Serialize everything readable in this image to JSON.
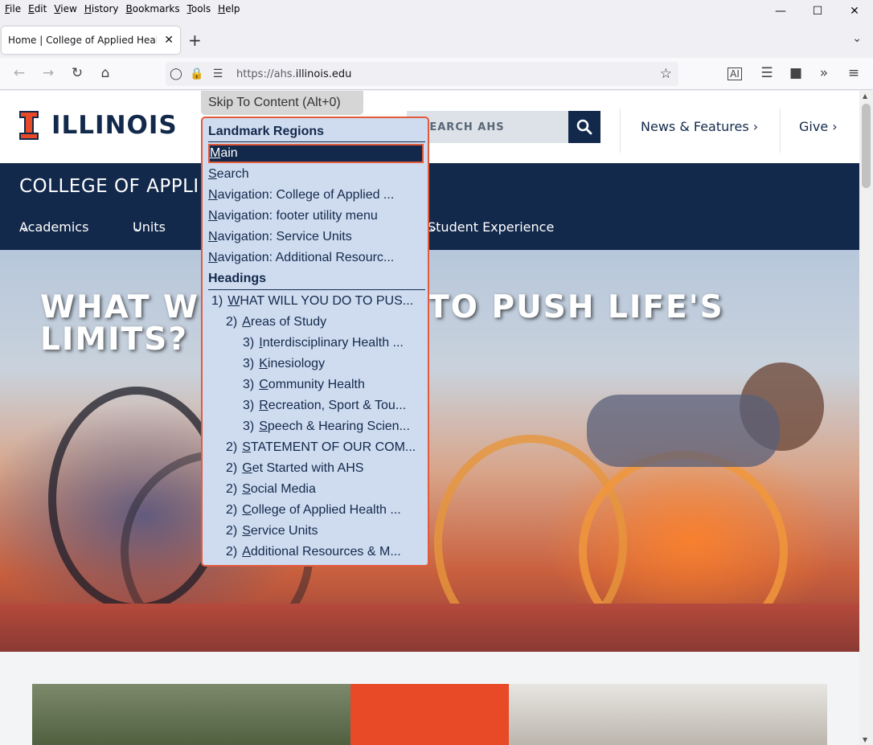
{
  "menubar": [
    "File",
    "Edit",
    "View",
    "History",
    "Bookmarks",
    "Tools",
    "Help"
  ],
  "tab": {
    "title": "Home | College of Applied Health Sciences"
  },
  "url": {
    "prefix": "https://ahs.",
    "domain": "illinois.edu"
  },
  "site": {
    "logo_text": "ILLINOIS",
    "search_placeholder": "SEARCH AHS",
    "header_links": [
      "News & Features",
      "Give"
    ],
    "college_name": "COLLEGE OF APPLIED HEALTH SCIENCES",
    "nav": [
      "Academics",
      "Units",
      "Student Experience"
    ],
    "hero_title": "WHAT WILL YOU DO TO PUSH LIFE'S LIMITS?"
  },
  "skipto": {
    "button": "Skip To Content (Alt+0)",
    "landmarks_label": "Landmark Regions",
    "landmarks": [
      "Main",
      "Search",
      "Navigation: College of Applied ...",
      "Navigation: footer utility menu",
      "Navigation: Service Units",
      "Navigation: Additional Resourc..."
    ],
    "headings_label": "Headings",
    "headings": [
      {
        "level": "1)",
        "text": "WHAT WILL YOU DO TO PUS..."
      },
      {
        "level": "2)",
        "text": "Areas of Study"
      },
      {
        "level": "3)",
        "text": "Interdisciplinary Health ..."
      },
      {
        "level": "3)",
        "text": "Kinesiology"
      },
      {
        "level": "3)",
        "text": "Community Health"
      },
      {
        "level": "3)",
        "text": "Recreation, Sport & Tou..."
      },
      {
        "level": "3)",
        "text": "Speech & Hearing Scien..."
      },
      {
        "level": "2)",
        "text": "STATEMENT OF OUR COM..."
      },
      {
        "level": "2)",
        "text": "Get Started with AHS"
      },
      {
        "level": "2)",
        "text": "Social Media"
      },
      {
        "level": "2)",
        "text": "College of Applied Health ..."
      },
      {
        "level": "2)",
        "text": "Service Units"
      },
      {
        "level": "2)",
        "text": "Additional Resources & M..."
      }
    ]
  },
  "colors": {
    "illini_blue": "#13294b",
    "illini_orange": "#e84a27",
    "menu_bg": "#cfdcf0"
  }
}
